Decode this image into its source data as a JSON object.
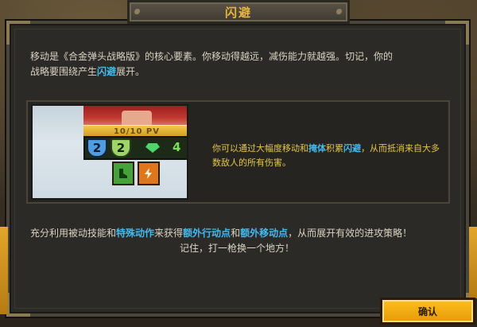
{
  "dialog": {
    "title": "闪避",
    "intro": {
      "p1": "移动是《合金弹头战略版》的核心要素。你移动得越远，减伤能力就越强。切记，你的",
      "p2a": "战略要围绕产生",
      "p2_hl": "闪避",
      "p2b": "展开。"
    },
    "figure": {
      "hp_label": "10/10 PV",
      "shield_blue_value": "2",
      "shield_green_value": "2",
      "gem_count": "4",
      "text": {
        "a": "你可以通过大幅度移动和",
        "b_hl": "掩体",
        "c": "积累",
        "d_hl": "闪避",
        "e": "，从而抵消来自大多数敌人的所有伤害。"
      }
    },
    "outro": {
      "a": "充分利用被动技能和",
      "b_hl": "特殊动作",
      "c": "来获得",
      "d_hl": "额外行动点",
      "e": "和",
      "f_hl": "额外移动点",
      "g": "，从而展开有效的进攻策略！",
      "line2": "记住，打一枪换一个地方！"
    },
    "confirm_label": "确认"
  },
  "colors": {
    "accent_yellow": "#e9b640",
    "highlight_blue": "#42b9ef",
    "body_text": "#d9d3c3",
    "figure_text": "#e4c64a",
    "button_bg": "#ffbf1c"
  },
  "icons": [
    "shield-blue-icon",
    "shield-green-icon",
    "gem-icon",
    "move-action-icon",
    "skill-action-icon"
  ]
}
